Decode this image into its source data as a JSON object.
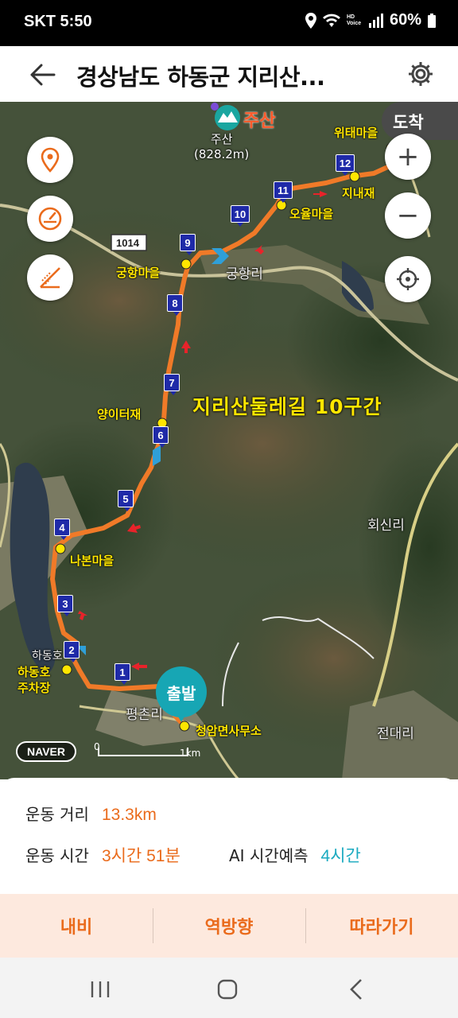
{
  "status_bar": {
    "carrier_time": "SKT 5:50",
    "battery": "60%",
    "volte_label": "HD Voice"
  },
  "header": {
    "title": "경상남도 하동군 지리산...",
    "back_icon": "arrow-left-icon",
    "settings_icon": "gear-icon"
  },
  "map": {
    "arrive_label": "도착",
    "start_label": "출발",
    "course_title": "지리산둘레길 10구간",
    "peak_name": "주산",
    "peak_elevation": "(828.2m)",
    "peak_badge_label": "주산",
    "road_number": "1014",
    "brand": "NAVER",
    "scale_zero": "0",
    "scale_km": "1km",
    "route_color": "#f07a28",
    "places_yellow": {
      "witae": "위태마을",
      "jinaejae": "지내재",
      "oyul": "오율마을",
      "gunghang": "궁항마을",
      "yangiteojae": "양이터재",
      "nabon": "나본마을",
      "hadongho_parking_1": "하동호",
      "hadongho_parking_2": "주차장",
      "cheongam_office": "청암면사무소"
    },
    "places_white": {
      "gunghangri": "궁항리",
      "hoesinri": "회신리",
      "jeondaeri": "전대리",
      "pyeongchon": "평촌리",
      "hadong": "하동호"
    },
    "markers": [
      "1",
      "2",
      "3",
      "4",
      "5",
      "6",
      "7",
      "8",
      "9",
      "10",
      "11",
      "12"
    ],
    "controls": {
      "location_icon": "map-pin-icon",
      "speed_icon": "speedometer-icon",
      "slope_icon": "slope-icon",
      "zoom_in": "+",
      "zoom_out": "−",
      "recenter_icon": "crosshair-icon"
    }
  },
  "stats": {
    "distance_label": "운동 거리",
    "distance_value": "13.3km",
    "time_label": "운동 시간",
    "time_value": "3시간 51분",
    "ai_label": "AI 시간예측",
    "ai_value": "4시간"
  },
  "actions": {
    "navi": "내비",
    "reverse": "역방향",
    "follow": "따라가기"
  },
  "navbar": {
    "recent_icon": "recent-apps-icon",
    "home_icon": "home-icon",
    "back_icon": "nav-back-icon"
  }
}
